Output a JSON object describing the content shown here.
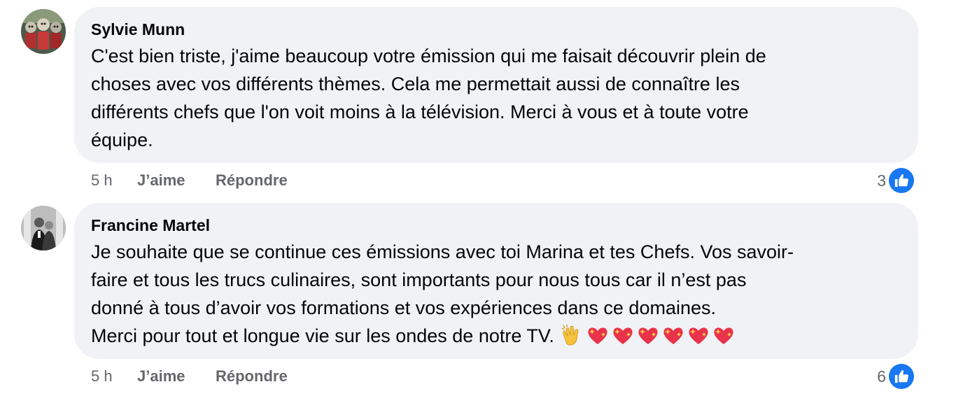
{
  "colors": {
    "bubble_bg": "#f0f2f5",
    "meta_text": "#65676b",
    "like_blue": "#1877f2"
  },
  "comments": [
    {
      "author": "Sylvie Munn",
      "text": "C'est bien triste, j'aime beaucoup votre émission qui me faisait découvrir plein de\nchoses avec vos différents thèmes. Cela me permettait aussi de connaître les\ndifférents chefs que l'on voit moins à la télévision. Merci à vous et à toute votre\néquipe.",
      "time": "5 h",
      "like_label": "J’aime",
      "reply_label": "Répondre",
      "reaction_count": "3",
      "reaction_icon": "thumbs-up-icon"
    },
    {
      "author": "Francine Martel",
      "text": "Je souhaite que se continue ces émissions avec toi Marina et tes Chefs. Vos savoir-\nfaire et tous les trucs culinaires, sont importants pour nous tous car il n’est pas\ndonné à tous d’avoir vos formations et vos expériences dans ce domaines.\nMerci pour tout et longue vie sur les ondes de notre TV.",
      "emojis": [
        "clapping-hands-icon",
        "sparkling-heart-icon",
        "sparkling-heart-icon",
        "sparkling-heart-icon",
        "sparkling-heart-icon",
        "sparkling-heart-icon",
        "sparkling-heart-icon"
      ],
      "time": "5 h",
      "like_label": "J’aime",
      "reply_label": "Répondre",
      "reaction_count": "6",
      "reaction_icon": "thumbs-up-icon"
    }
  ]
}
